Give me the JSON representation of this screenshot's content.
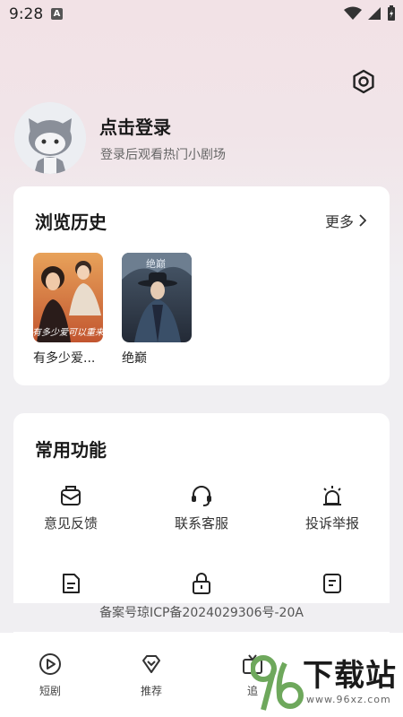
{
  "status": {
    "time": "9:28",
    "a_badge": "A"
  },
  "header": {
    "login_title": "点击登录",
    "login_sub": "登录后观看热门小剧场"
  },
  "history": {
    "title": "浏览历史",
    "more_label": "更多",
    "items": [
      {
        "name": "有多少爱...",
        "poster_text": "有多少爱可以重来"
      },
      {
        "name": "绝巅",
        "poster_text": "绝巅"
      }
    ]
  },
  "functions": {
    "title": "常用功能",
    "items": [
      {
        "label": "意见反馈",
        "icon": "feedback-icon"
      },
      {
        "label": "联系客服",
        "icon": "headset-icon"
      },
      {
        "label": "投诉举报",
        "icon": "alarm-icon"
      },
      {
        "label": "",
        "icon": "document-icon"
      },
      {
        "label": "",
        "icon": "lock-icon"
      },
      {
        "label": "",
        "icon": "note-icon"
      }
    ]
  },
  "icp": "备案号琼ICP备2024029306号-20A",
  "tabs": [
    {
      "label": "短剧",
      "icon": "play-circle-icon"
    },
    {
      "label": "推荐",
      "icon": "heart-diamond-icon"
    },
    {
      "label": "追",
      "icon": "tv-icon"
    }
  ],
  "watermark": {
    "number": "96",
    "text": "下载站",
    "url": "www.96xz.com"
  },
  "colors": {
    "accent": "#6ea85c",
    "text": "#1a1a1a",
    "background": "#f0eff2"
  }
}
